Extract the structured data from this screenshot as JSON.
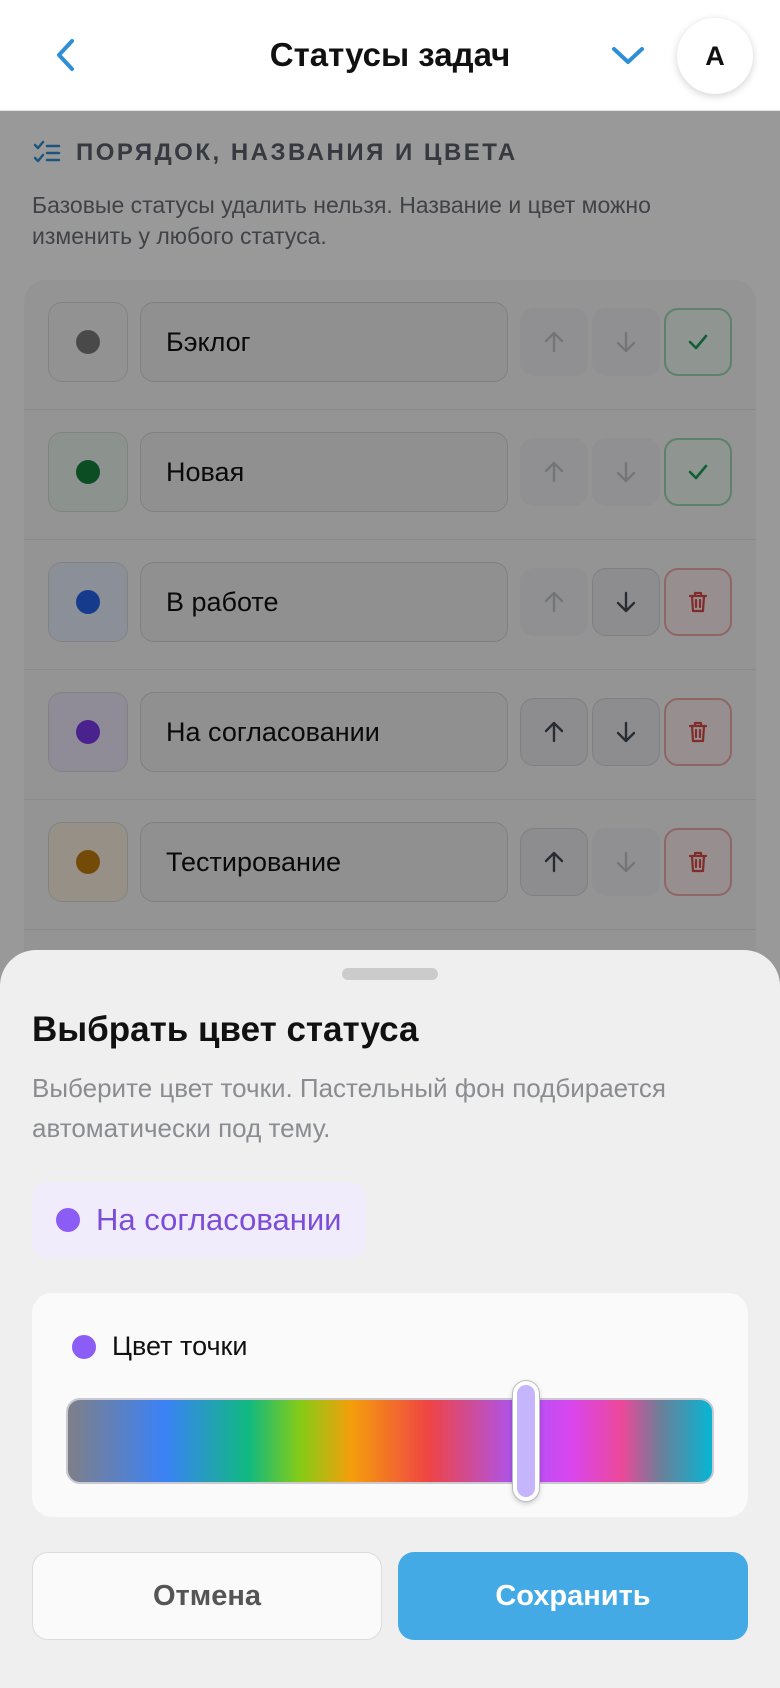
{
  "header": {
    "title": "Статусы задач",
    "avatar_letter": "A",
    "accent_color": "#2f8fd6"
  },
  "section": {
    "title": "ПОРЯДОК, НАЗВАНИЯ И ЦВЕТА",
    "description": "Базовые статусы удалить нельзя. Название и цвет можно изменить у любого статуса."
  },
  "statuses": [
    {
      "name": "Бэклог",
      "dot_color": "#7a7a7a",
      "swatch_bg": "#f4f4f5",
      "up_enabled": false,
      "down_enabled": false,
      "action": "check"
    },
    {
      "name": "Новая",
      "dot_color": "#15803d",
      "swatch_bg": "#e9f6ee",
      "up_enabled": false,
      "down_enabled": false,
      "action": "check"
    },
    {
      "name": "В работе",
      "dot_color": "#2563eb",
      "swatch_bg": "#e8f0fd",
      "up_enabled": false,
      "down_enabled": true,
      "action": "delete"
    },
    {
      "name": "На согласовании",
      "dot_color": "#7c3aed",
      "swatch_bg": "#efe9fd",
      "up_enabled": true,
      "down_enabled": true,
      "action": "delete"
    },
    {
      "name": "Тестирование",
      "dot_color": "#c27c0e",
      "swatch_bg": "#fbf1e2",
      "up_enabled": true,
      "down_enabled": false,
      "action": "delete"
    }
  ],
  "sheet": {
    "title": "Выбрать цвет статуса",
    "description": "Выберите цвет точки. Пастельный фон подбирается автоматически под тему.",
    "preview_label": "На согласовании",
    "preview_dot_color": "#8b5cf6",
    "picker_label": "Цвет точки",
    "hue_value": 0.71,
    "cancel_label": "Отмена",
    "save_label": "Сохранить",
    "save_color": "#44aae6"
  }
}
